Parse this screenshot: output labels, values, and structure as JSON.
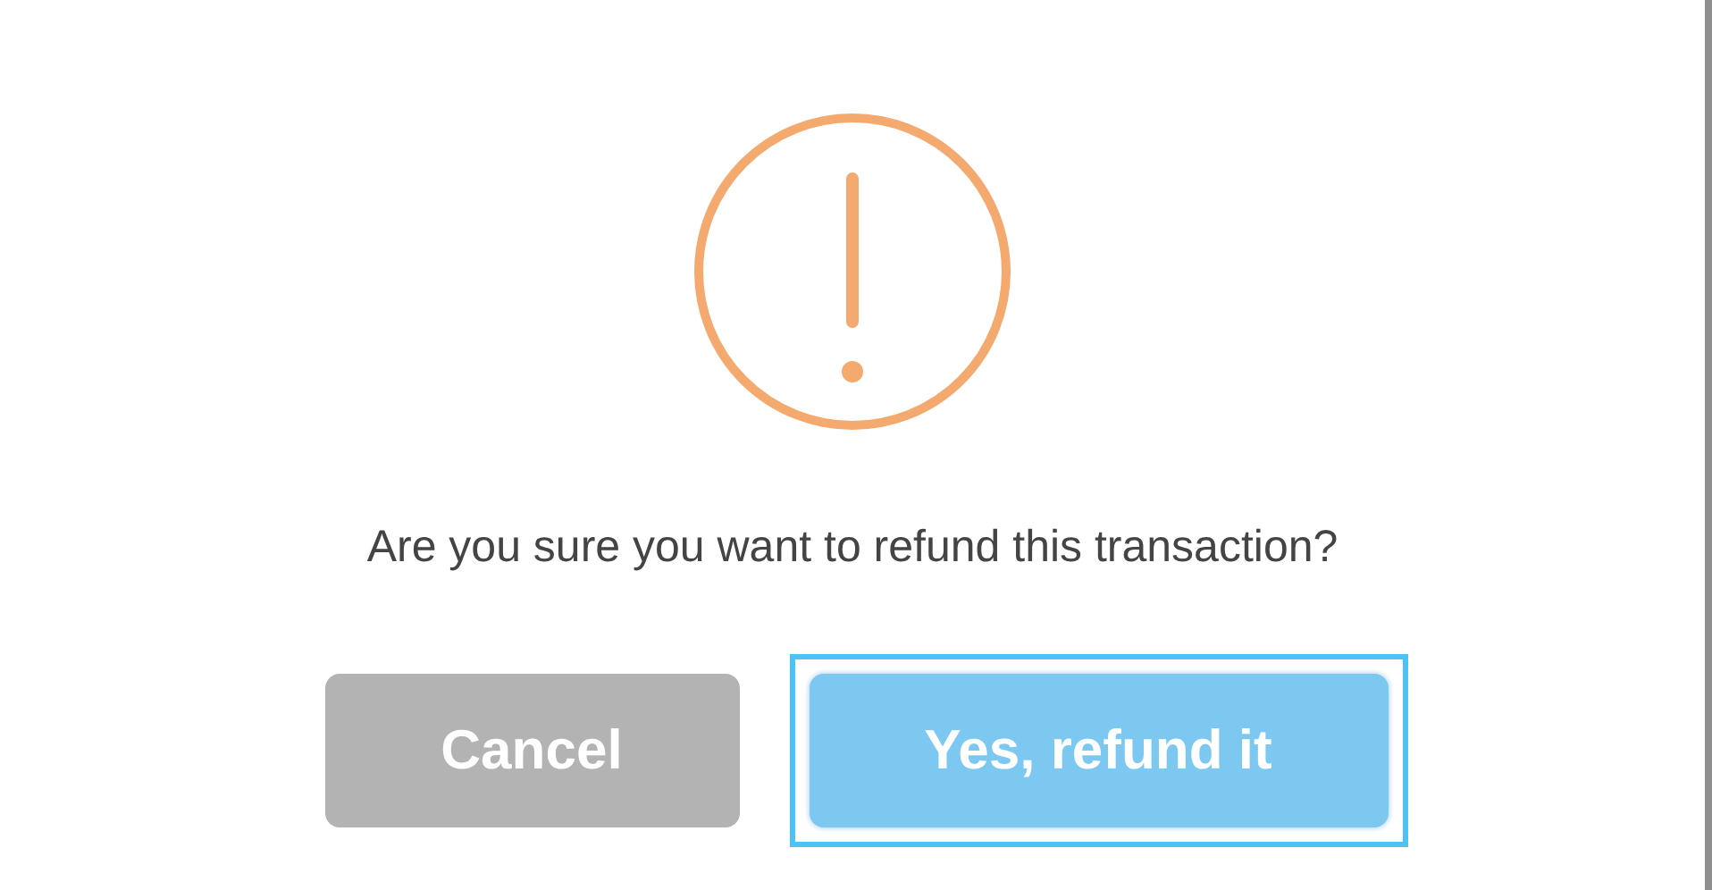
{
  "dialog": {
    "icon": {
      "kind": "warning"
    },
    "message": "Are you sure you want to refund this transaction?",
    "buttons": [
      {
        "label": "Cancel",
        "kind": "cancel",
        "focused": false
      },
      {
        "label": "Yes, refund it",
        "kind": "confirm",
        "focused": true
      }
    ]
  }
}
